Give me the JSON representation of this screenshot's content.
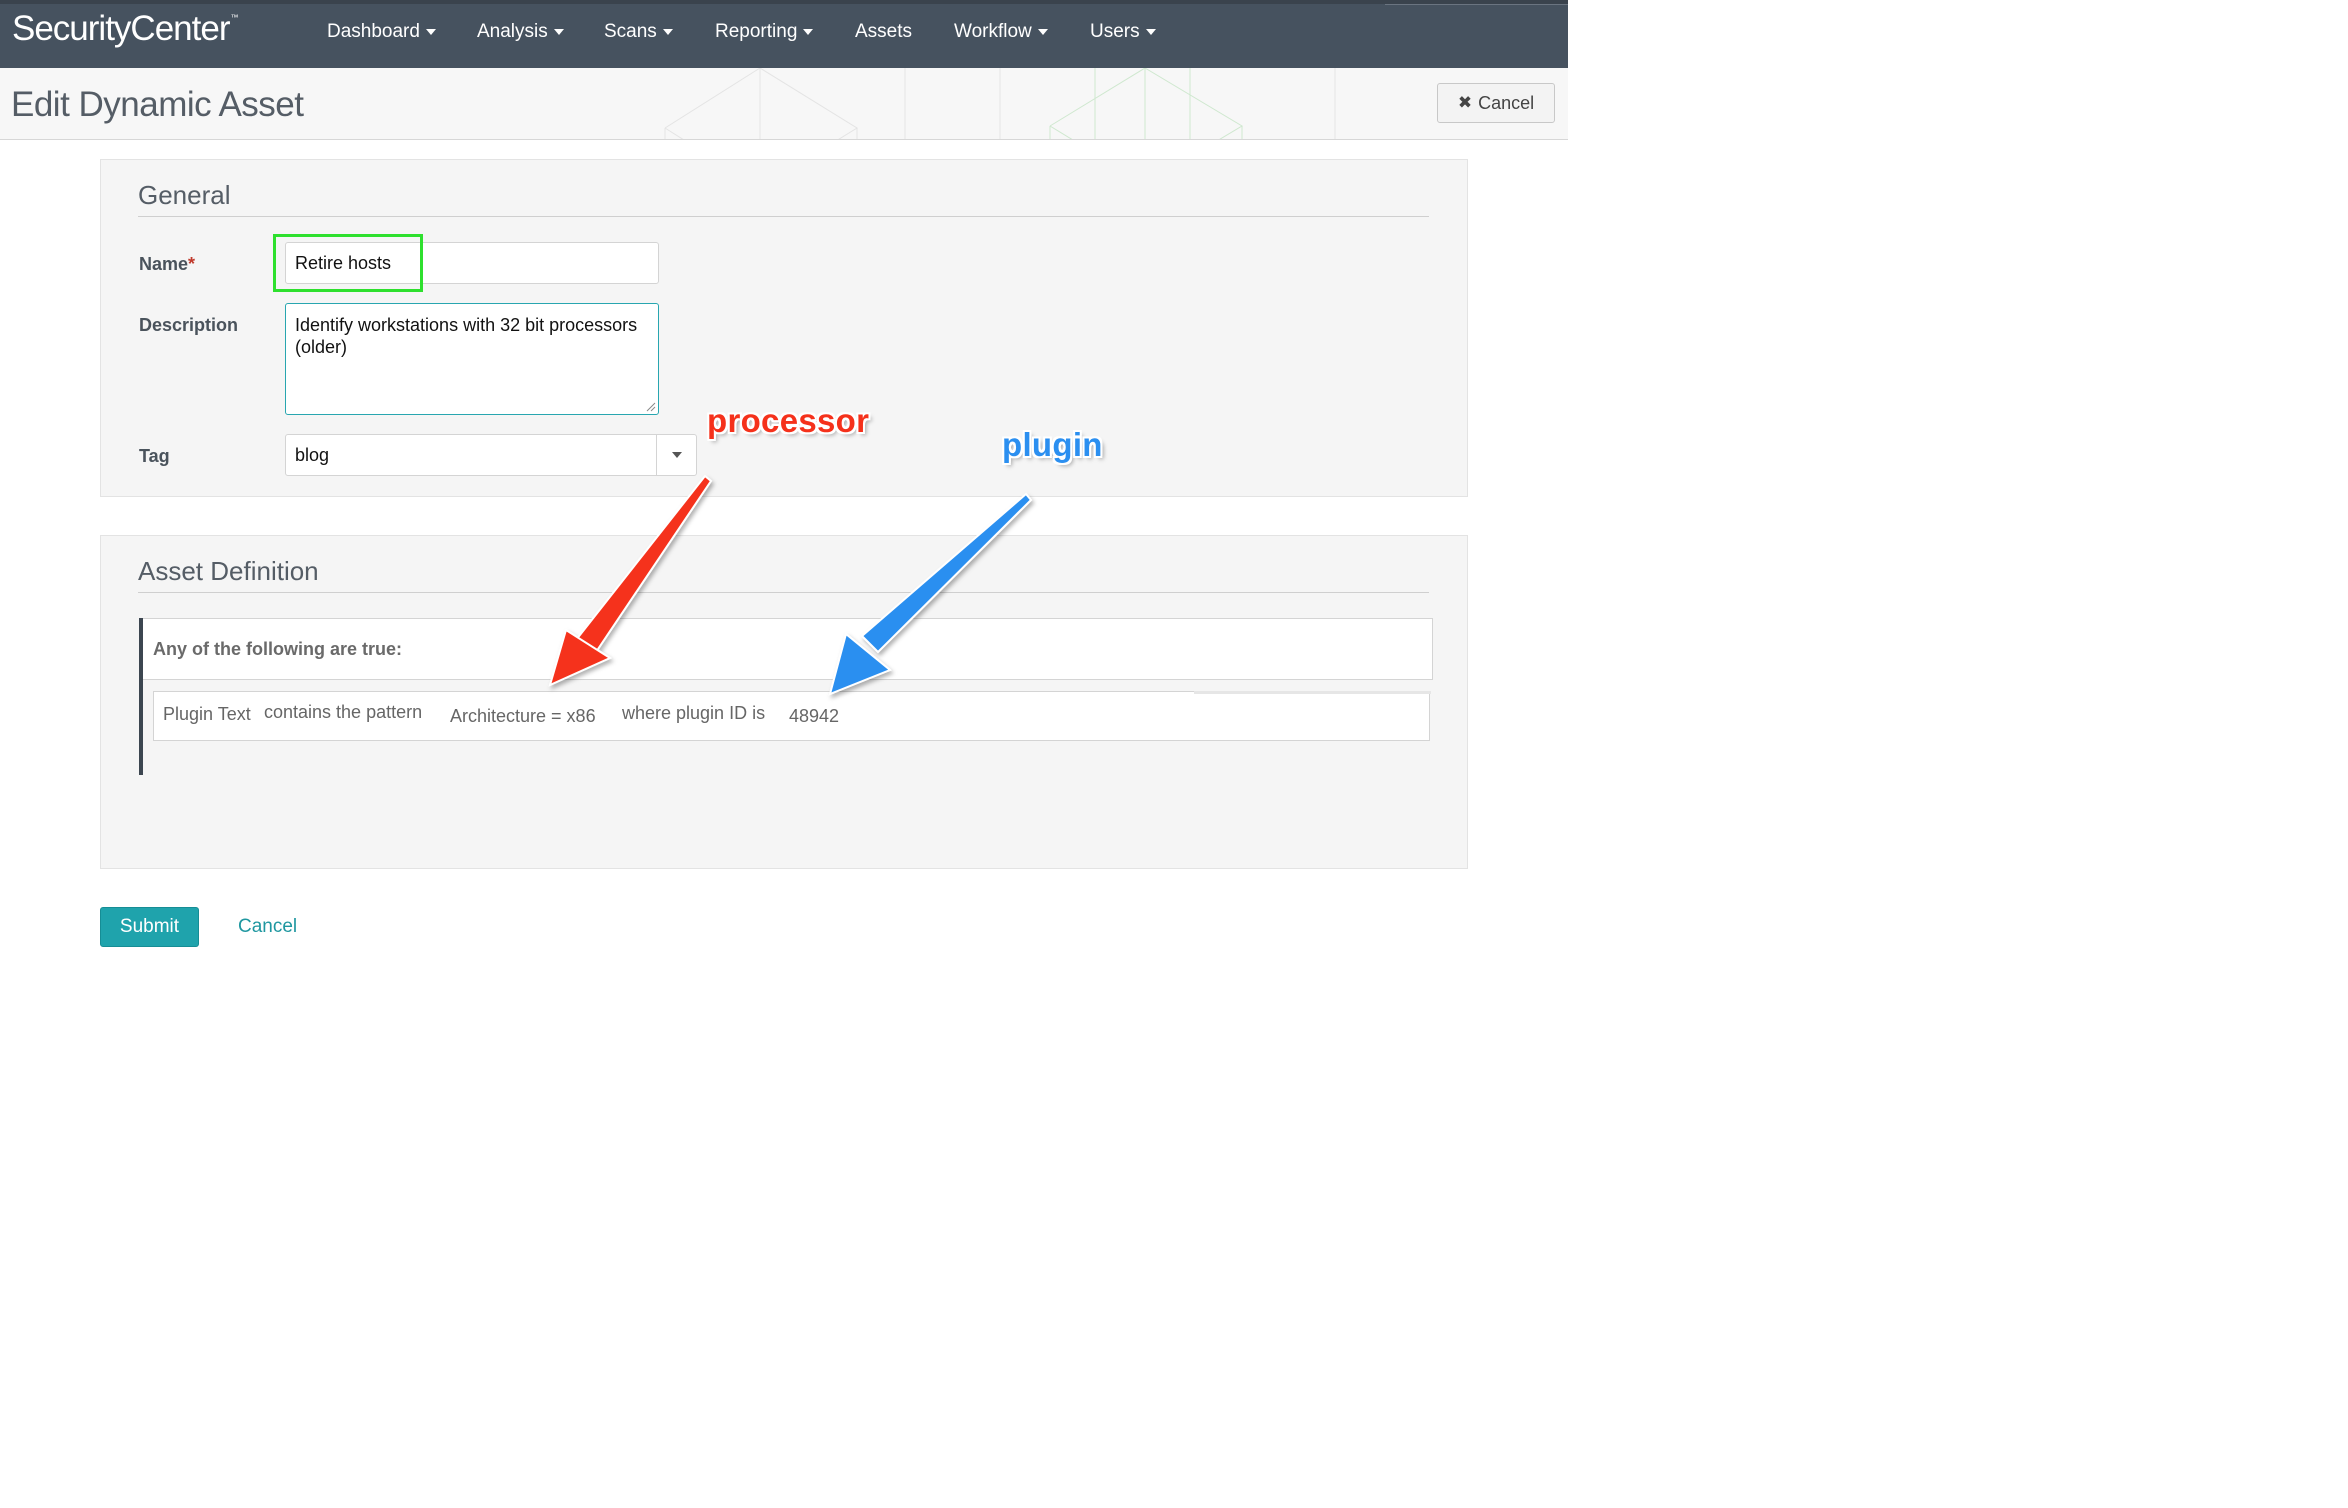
{
  "app": {
    "brand": "SecurityCenter",
    "brand_mark": "™"
  },
  "nav": {
    "items": [
      {
        "label": "Dashboard",
        "dropdown": true
      },
      {
        "label": "Analysis",
        "dropdown": true
      },
      {
        "label": "Scans",
        "dropdown": true
      },
      {
        "label": "Reporting",
        "dropdown": true
      },
      {
        "label": "Assets",
        "dropdown": false
      },
      {
        "label": "Workflow",
        "dropdown": true
      },
      {
        "label": "Users",
        "dropdown": true
      }
    ]
  },
  "header": {
    "title": "Edit Dynamic Asset",
    "cancel_icon": "times-icon",
    "cancel_label": "Cancel"
  },
  "general": {
    "title": "General",
    "name_label": "Name",
    "required_mark": "*",
    "name_value": "Retire hosts",
    "description_label": "Description",
    "description_value": "Identify workstations with 32 bit processors (older)",
    "tag_label": "Tag",
    "tag_value": "blog"
  },
  "asset_definition": {
    "title": "Asset Definition",
    "group_heading": "Any of the following are true:",
    "rule": {
      "field": "Plugin Text",
      "operator": "contains the pattern",
      "pattern": "Architecture = x86",
      "qualifier": "where plugin ID is",
      "plugin_id": "48942"
    }
  },
  "footer": {
    "submit_label": "Submit",
    "cancel_label": "Cancel"
  },
  "annotations": {
    "processor_label": "processor",
    "plugin_label": "plugin",
    "highlight_color": "#2ee02e",
    "processor_color": "#f5311b",
    "plugin_color": "#2b8ff0"
  },
  "colors": {
    "navbar": "#46525f",
    "accent": "#1fa3ac",
    "panel_bg": "#f5f5f5"
  }
}
